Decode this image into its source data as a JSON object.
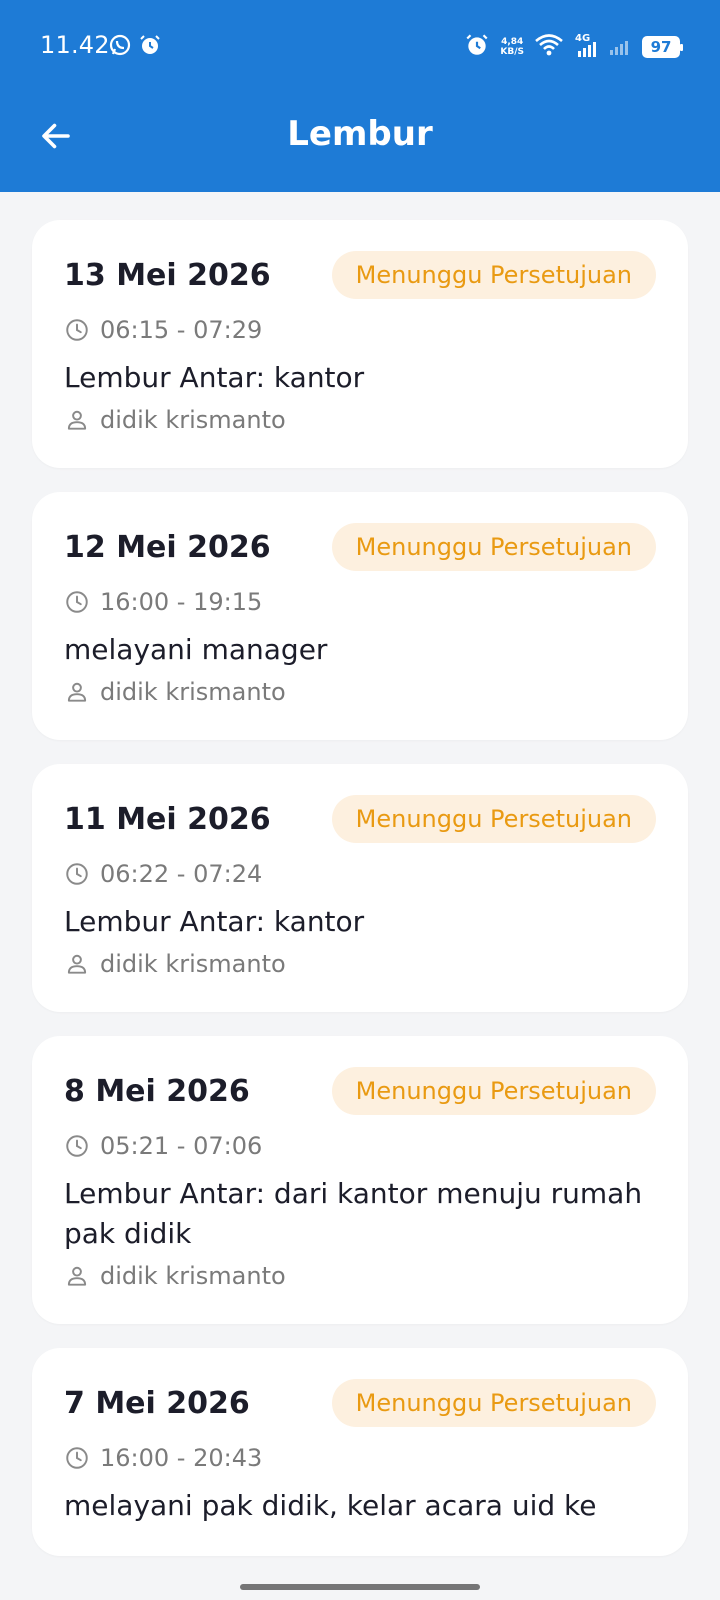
{
  "status_bar": {
    "time": "11.42",
    "net_speed_value": "4,84",
    "net_speed_unit": "KB/S",
    "network_type": "4G",
    "battery": "97"
  },
  "app_bar": {
    "title": "Lembur",
    "back_icon": "arrow-left-icon"
  },
  "colors": {
    "primary": "#1e7bd6",
    "badge_bg": "#fdf0df",
    "badge_text": "#e99a12",
    "background": "#f4f5f7"
  },
  "overtime_list": [
    {
      "date": "13 Mei 2026",
      "status": "Menunggu Persetujuan",
      "time": "06:15 - 07:29",
      "description": "Lembur Antar: kantor",
      "employee": "didik krismanto"
    },
    {
      "date": "12 Mei 2026",
      "status": "Menunggu Persetujuan",
      "time": "16:00 - 19:15",
      "description": "melayani manager",
      "employee": "didik krismanto"
    },
    {
      "date": "11 Mei 2026",
      "status": "Menunggu Persetujuan",
      "time": "06:22 - 07:24",
      "description": "Lembur Antar: kantor",
      "employee": "didik krismanto"
    },
    {
      "date": "8 Mei 2026",
      "status": "Menunggu Persetujuan",
      "time": "05:21 - 07:06",
      "description": "Lembur Antar: dari kantor menuju rumah pak didik",
      "employee": "didik krismanto"
    },
    {
      "date": "7 Mei 2026",
      "status": "Menunggu Persetujuan",
      "time": "16:00 - 20:43",
      "description": "melayani pak didik, kelar acara uid ke",
      "employee": ""
    }
  ]
}
